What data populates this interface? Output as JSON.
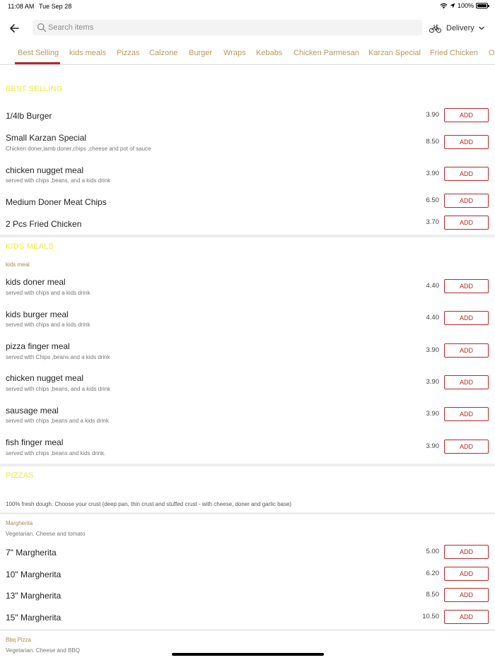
{
  "status_bar": {
    "time": "11:08 AM",
    "date": "Tue Sep 28",
    "battery": "100%"
  },
  "search": {
    "placeholder": "Search items"
  },
  "delivery": {
    "label": "Delivery"
  },
  "tabs": [
    "Best Selling",
    "kids meals",
    "Pizzas",
    "Calzone",
    "Burger",
    "Wraps",
    "Kebabs",
    "Chicken Parmesan",
    "Karzan Special",
    "Fried Chicken",
    "Ot"
  ],
  "add_label": "ADD",
  "best_selling": {
    "title": "BEST SELLING",
    "items": [
      {
        "name": "1/4lb Burger",
        "desc": "",
        "price": "3.90"
      },
      {
        "name": "Small Karzan Special",
        "desc": "Chicken doner,lamb doner,chips ,cheese and pot of sauce",
        "price": "8.50"
      },
      {
        "name": "chicken nugget meal",
        "desc": "served with chips ,beans, and a kids drink",
        "price": "3.90"
      },
      {
        "name": "Medium  Doner Meat Chips",
        "desc": "",
        "price": "6.50"
      },
      {
        "name": "2 Pcs Fried Chicken",
        "desc": "",
        "price": "3.70"
      }
    ]
  },
  "kids_meals": {
    "title": "KIDS MEALS",
    "subcategory": "kids meal",
    "items": [
      {
        "name": "kids doner meal",
        "desc": "served with chips and a kids drink",
        "price": "4.40"
      },
      {
        "name": "kids burger meal",
        "desc": "served with chips and a kids drink",
        "price": "4.40"
      },
      {
        "name": "pizza finger meal",
        "desc": "served with Chips ,beans and a kids drink",
        "price": "3.90"
      },
      {
        "name": "chicken nugget meal",
        "desc": "served with chips ,beans, and a kids drink",
        "price": "3.90"
      },
      {
        "name": "sausage meal",
        "desc": "served with chips ,beans and a kids drink",
        "price": "3.90"
      },
      {
        "name": "fish finger meal",
        "desc": "served with chips ,beans and kids drink.",
        "price": "3.90"
      }
    ]
  },
  "pizzas": {
    "title": "PIZZAS",
    "info": "100% fresh dough. Choose your crust (deep pan, thin crust and stuffed crust - with cheese, doner and garlic base)",
    "margherita_group": {
      "name": "Margherita",
      "desc": "Vegetarian. Cheese and tomato"
    },
    "items": [
      {
        "name": "7\" Margherita",
        "price": "5.00"
      },
      {
        "name": "10\" Margherita",
        "price": "6.20"
      },
      {
        "name": "13\" Margherita",
        "price": "8.50"
      },
      {
        "name": "15\" Margherita",
        "price": "10.50"
      }
    ],
    "bbq_group": {
      "name": "Bbq Pizza",
      "desc": "Vegetarian. Cheese and BBQ"
    }
  },
  "colors": {
    "accent": "#b5282a",
    "section_title": "#e6ec3b",
    "tab_text": "#b59a62"
  }
}
